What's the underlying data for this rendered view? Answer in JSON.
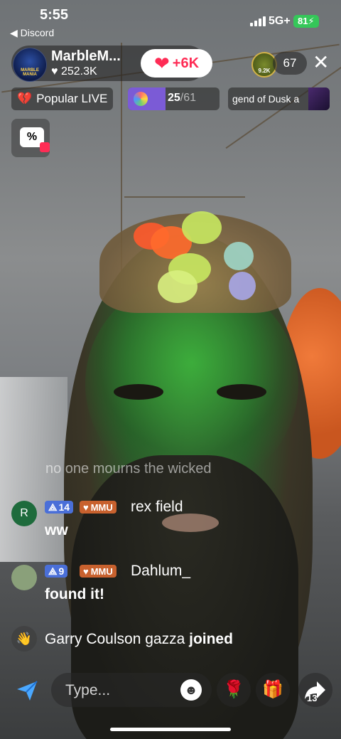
{
  "status_bar": {
    "time": "5:55",
    "back_app": "◀ Discord",
    "network": "5G+",
    "battery": "81"
  },
  "host": {
    "name": "MarbleM...",
    "logo_text": "MARBLE MANIA",
    "likes": "♥ 252.3K",
    "follow_label": "+6K"
  },
  "viewers": {
    "top_viewer_label": "9.2K",
    "count": "67"
  },
  "tags": {
    "popular": "Popular LIVE",
    "rank_current": "25",
    "rank_total": "/61",
    "rank_progress": 0.41,
    "game": "gend of Dusk a"
  },
  "promo": {
    "label": "%"
  },
  "lyric": "no one mourns the wicked",
  "comments": [
    {
      "avatar_letter": "R",
      "avatar_color": "#1e6b3c",
      "level": "14",
      "fan_badge": "MMU",
      "user": "rex field",
      "text": "ww"
    },
    {
      "avatar_letter": "",
      "avatar_color": "#8aa07a",
      "level": "9",
      "fan_badge": "MMU",
      "user": "Dahlum_",
      "text": "found it!"
    }
  ],
  "joined": {
    "name": "Garry Coulson gazza",
    "action": "joined"
  },
  "bottom_bar": {
    "input_placeholder": "Type...",
    "share_count": "13"
  },
  "colors": {
    "accent": "#fe2c55",
    "fan_badge": "#c8612e",
    "level_badge": "#4a6fd8",
    "rank_fill": "#7b5bd6"
  }
}
